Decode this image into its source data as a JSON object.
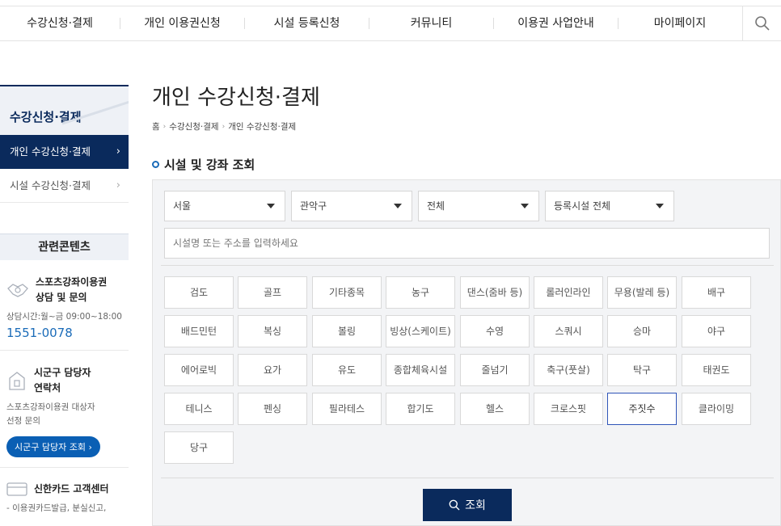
{
  "topnav": {
    "items": [
      "수강신청·결제",
      "개인 이용권신청",
      "시설 등록신청",
      "커뮤니티",
      "이용권 사업안내",
      "마이페이지"
    ]
  },
  "sidebar": {
    "title": "수강신청·결제",
    "items": [
      {
        "label": "개인 수강신청·결제",
        "active": true
      },
      {
        "label": "시설 수강신청·결제",
        "active": false
      }
    ],
    "related_title": "관련콘텐츠",
    "blocks": [
      {
        "title_line1": "스포츠강좌이용권",
        "title_line2": "상담 및 문의",
        "desc": "상담시간:월~금 09:00~18:00",
        "phone": "1551-0078"
      },
      {
        "title_line1": "시군구 담당자",
        "title_line2": "연락처",
        "desc_line1": "스포츠강좌이용권 대상자",
        "desc_line2": "선정 문의",
        "button": "시군구 담당자 조회 ›"
      },
      {
        "title": "신한카드 고객센터",
        "desc": "- 이용권카드발급, 분실신고,"
      }
    ]
  },
  "main": {
    "title": "개인 수강신청·결제",
    "breadcrumb": [
      "홈",
      "수강신청·결제",
      "개인 수강신청·결제"
    ],
    "section_title": "시설 및 강좌 조회"
  },
  "filters": {
    "region": "서울",
    "district": "관악구",
    "category": "전체",
    "facility": "등록시설 전체",
    "search_placeholder": "시설명 또는 주소를 입력하세요"
  },
  "sports": [
    "검도",
    "골프",
    "기타종목",
    "농구",
    "댄스(줌바 등)",
    "롤러인라인",
    "무용(발레 등)",
    "배구",
    "배드민턴",
    "복싱",
    "볼링",
    "빙상(스케이트)",
    "수영",
    "스쿼시",
    "승마",
    "야구",
    "에어로빅",
    "요가",
    "유도",
    "종합체육시설",
    "줄넘기",
    "축구(풋살)",
    "탁구",
    "태권도",
    "테니스",
    "펜싱",
    "필라테스",
    "합기도",
    "헬스",
    "크로스핏",
    "주짓수",
    "클라이밍",
    "당구"
  ],
  "selected_sport": "주짓수",
  "search_button": "조회",
  "colors": {
    "navy": "#0a2a5c",
    "accent": "#1a6bb8",
    "selected_border": "#2f55b8"
  }
}
